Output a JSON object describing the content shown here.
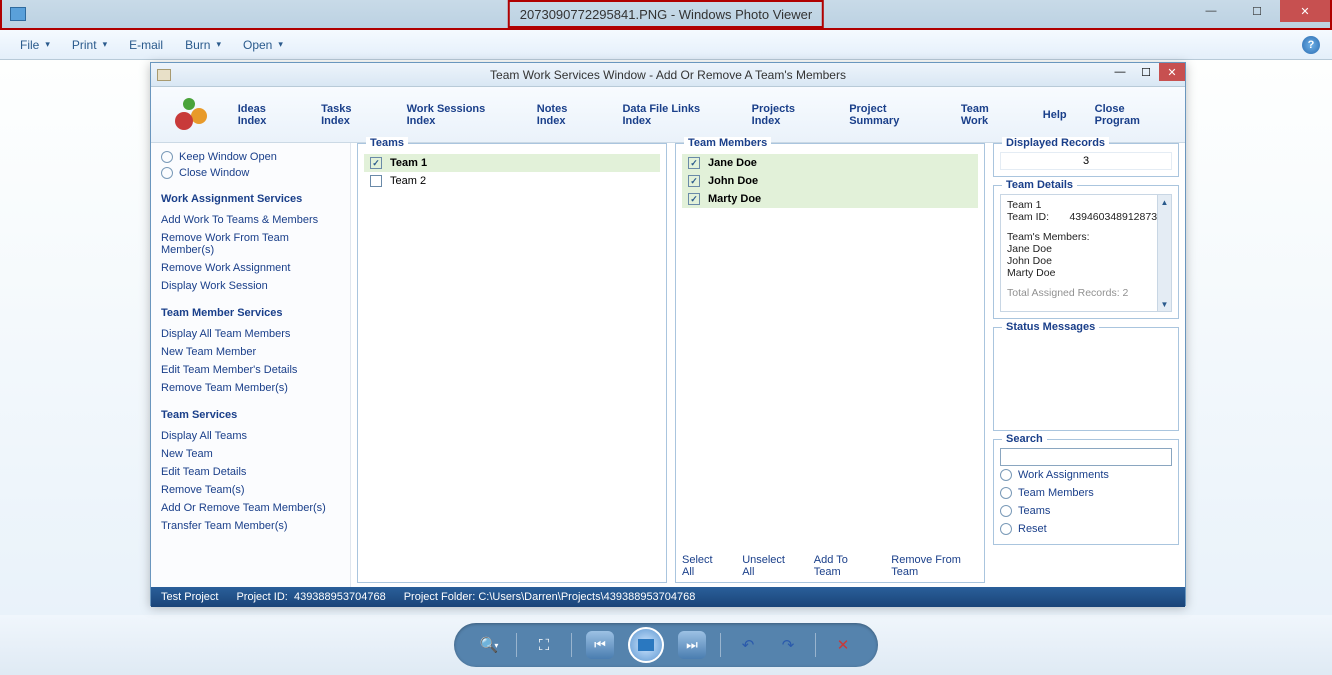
{
  "photo_viewer": {
    "title": "2073090772295841.PNG - Windows Photo Viewer",
    "menu": [
      "File",
      "Print",
      "E-mail",
      "Burn",
      "Open"
    ]
  },
  "app": {
    "title": "Team Work Services Window - Add Or Remove A Team's Members",
    "toolbar": [
      "Ideas Index",
      "Tasks Index",
      "Work Sessions Index",
      "Notes Index",
      "Data File Links Index",
      "Projects Index",
      "Project Summary",
      "Team Work",
      "Help",
      "Close Program"
    ],
    "window_options": {
      "keep": "Keep Window Open",
      "close": "Close Window"
    },
    "side_sections": [
      {
        "heading": "Work Assignment Services",
        "links": [
          "Add Work To Teams & Members",
          "Remove Work From Team Member(s)",
          "Remove Work Assignment",
          "Display Work Session"
        ]
      },
      {
        "heading": "Team Member Services",
        "links": [
          "Display All Team Members",
          "New Team Member",
          "Edit Team Member's Details",
          "Remove Team Member(s)"
        ]
      },
      {
        "heading": "Team Services",
        "links": [
          "Display All Teams",
          "New Team",
          "Edit Team Details",
          "Remove Team(s)",
          "Add Or Remove Team Member(s)",
          "Transfer Team Member(s)"
        ]
      }
    ],
    "teams_panel": {
      "title": "Teams",
      "items": [
        {
          "label": "Team 1",
          "checked": true,
          "sel": true
        },
        {
          "label": "Team 2",
          "checked": false,
          "sel": false
        }
      ]
    },
    "members_panel": {
      "title": "Team Members",
      "items": [
        {
          "label": "Jane Doe",
          "checked": true
        },
        {
          "label": "John Doe",
          "checked": true
        },
        {
          "label": "Marty Doe",
          "checked": true
        }
      ],
      "actions": [
        "Select All",
        "Unselect All",
        "Add To Team",
        "Remove From Team"
      ]
    },
    "displayed_records": {
      "title": "Displayed Records",
      "value": "3"
    },
    "team_details": {
      "title": "Team Details",
      "team_name": "Team 1",
      "team_id_label": "Team ID:",
      "team_id": "439460348912873",
      "members_heading": "Team's Members:",
      "members": [
        "Jane Doe",
        "John Doe",
        "Marty Doe"
      ],
      "cutoff": "Total Assigned Records:        2"
    },
    "status_messages": {
      "title": "Status Messages"
    },
    "search": {
      "title": "Search",
      "options": [
        "Work Assignments",
        "Team Members",
        "Teams",
        "Reset"
      ]
    },
    "statusbar": {
      "project": "Test Project",
      "project_id_label": "Project ID:",
      "project_id": "439388953704768",
      "folder_label": "Project Folder:",
      "folder": "C:\\Users\\Darren\\Projects\\439388953704768"
    }
  }
}
